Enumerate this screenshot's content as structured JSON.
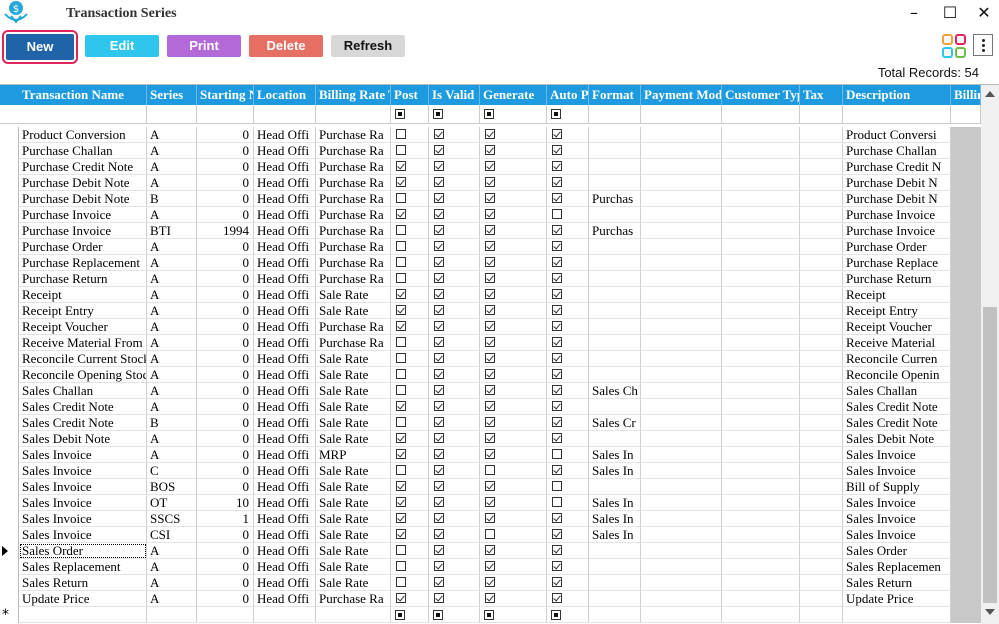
{
  "window": {
    "title": "Transaction Series"
  },
  "toolbar": {
    "new": "New",
    "edit": "Edit",
    "print": "Print",
    "delete": "Delete",
    "refresh": "Refresh"
  },
  "total_records": "Total Records: 54",
  "columns": [
    "Transaction Name",
    "Series",
    "Starting N",
    "Location",
    "Billing Rate Type",
    "Post",
    "Is Valid",
    "Generate",
    "Auto Post",
    "Format",
    "Payment Mode Type",
    "Customer Type",
    "Tax",
    "Description",
    "Billing"
  ],
  "rows": [
    {
      "name": "Product Conversion",
      "series": "A",
      "start": "0",
      "loc": "Head Offi",
      "rate": "Purchase Ra",
      "post": false,
      "valid": true,
      "gen": true,
      "auto": true,
      "fmt": "",
      "desc": "Product Conversi"
    },
    {
      "name": "Purchase Challan",
      "series": "A",
      "start": "0",
      "loc": "Head Offi",
      "rate": "Purchase Ra",
      "post": false,
      "valid": true,
      "gen": true,
      "auto": true,
      "fmt": "",
      "desc": "Purchase Challan"
    },
    {
      "name": "Purchase Credit Note",
      "series": "A",
      "start": "0",
      "loc": "Head Offi",
      "rate": "Purchase Ra",
      "post": true,
      "valid": true,
      "gen": true,
      "auto": true,
      "fmt": "",
      "desc": "Purchase Credit N"
    },
    {
      "name": "Purchase Debit Note",
      "series": "A",
      "start": "0",
      "loc": "Head Offi",
      "rate": "Purchase Ra",
      "post": true,
      "valid": true,
      "gen": true,
      "auto": true,
      "fmt": "",
      "desc": "Purchase Debit N"
    },
    {
      "name": "Purchase Debit Note",
      "series": "B",
      "start": "0",
      "loc": "Head Offi",
      "rate": "Purchase Ra",
      "post": false,
      "valid": true,
      "gen": true,
      "auto": true,
      "fmt": "Purchas",
      "desc": "Purchase Debit N"
    },
    {
      "name": "Purchase Invoice",
      "series": "A",
      "start": "0",
      "loc": "Head Offi",
      "rate": "Purchase Ra",
      "post": true,
      "valid": true,
      "gen": true,
      "auto": false,
      "fmt": "",
      "desc": "Purchase Invoice"
    },
    {
      "name": "Purchase Invoice",
      "series": "BTI",
      "start": "1994",
      "loc": "Head Offi",
      "rate": "Purchase Ra",
      "post": false,
      "valid": true,
      "gen": true,
      "auto": true,
      "fmt": "Purchas",
      "desc": "Purchase Invoice"
    },
    {
      "name": "Purchase Order",
      "series": "A",
      "start": "0",
      "loc": "Head Offi",
      "rate": "Purchase Ra",
      "post": false,
      "valid": true,
      "gen": true,
      "auto": true,
      "fmt": "",
      "desc": "Purchase Order"
    },
    {
      "name": "Purchase Replacement",
      "series": "A",
      "start": "0",
      "loc": "Head Offi",
      "rate": "Purchase Ra",
      "post": false,
      "valid": true,
      "gen": true,
      "auto": true,
      "fmt": "",
      "desc": "Purchase Replace"
    },
    {
      "name": "Purchase Return",
      "series": "A",
      "start": "0",
      "loc": "Head Offi",
      "rate": "Purchase Ra",
      "post": false,
      "valid": true,
      "gen": true,
      "auto": true,
      "fmt": "",
      "desc": "Purchase Return"
    },
    {
      "name": "Receipt",
      "series": "A",
      "start": "0",
      "loc": "Head Offi",
      "rate": "Sale Rate",
      "post": true,
      "valid": true,
      "gen": true,
      "auto": true,
      "fmt": "",
      "desc": "Receipt"
    },
    {
      "name": "Receipt Entry",
      "series": "A",
      "start": "0",
      "loc": "Head Offi",
      "rate": "Sale Rate",
      "post": true,
      "valid": true,
      "gen": true,
      "auto": true,
      "fmt": "",
      "desc": "Receipt Entry"
    },
    {
      "name": "Receipt Voucher",
      "series": "A",
      "start": "0",
      "loc": "Head Offi",
      "rate": "Purchase Ra",
      "post": true,
      "valid": true,
      "gen": true,
      "auto": true,
      "fmt": "",
      "desc": "Receipt Voucher"
    },
    {
      "name": "Receive Material From",
      "series": "A",
      "start": "0",
      "loc": "Head Offi",
      "rate": "Purchase Ra",
      "post": false,
      "valid": true,
      "gen": true,
      "auto": true,
      "fmt": "",
      "desc": "Receive Material"
    },
    {
      "name": "Reconcile Current Stock",
      "series": "A",
      "start": "0",
      "loc": "Head Offi",
      "rate": "Sale Rate",
      "post": false,
      "valid": true,
      "gen": true,
      "auto": true,
      "fmt": "",
      "desc": "Reconcile Curren"
    },
    {
      "name": "Reconcile Opening Stock",
      "series": "A",
      "start": "0",
      "loc": "Head Offi",
      "rate": "Sale Rate",
      "post": false,
      "valid": true,
      "gen": true,
      "auto": true,
      "fmt": "",
      "desc": "Reconcile Openin"
    },
    {
      "name": "Sales Challan",
      "series": "A",
      "start": "0",
      "loc": "Head Offi",
      "rate": "Sale Rate",
      "post": false,
      "valid": true,
      "gen": true,
      "auto": true,
      "fmt": "Sales Ch",
      "desc": "Sales Challan"
    },
    {
      "name": "Sales Credit Note",
      "series": "A",
      "start": "0",
      "loc": "Head Offi",
      "rate": "Sale Rate",
      "post": true,
      "valid": true,
      "gen": true,
      "auto": true,
      "fmt": "",
      "desc": "Sales Credit Note"
    },
    {
      "name": "Sales Credit Note",
      "series": "B",
      "start": "0",
      "loc": "Head Offi",
      "rate": "Sale Rate",
      "post": false,
      "valid": true,
      "gen": true,
      "auto": true,
      "fmt": "Sales Cr",
      "desc": "Sales Credit Note"
    },
    {
      "name": "Sales Debit Note",
      "series": "A",
      "start": "0",
      "loc": "Head Offi",
      "rate": "Sale Rate",
      "post": true,
      "valid": true,
      "gen": true,
      "auto": true,
      "fmt": "",
      "desc": "Sales Debit Note"
    },
    {
      "name": "Sales Invoice",
      "series": "A",
      "start": "0",
      "loc": "Head Offi",
      "rate": "MRP",
      "post": true,
      "valid": true,
      "gen": true,
      "auto": false,
      "fmt": "Sales In",
      "desc": "Sales Invoice"
    },
    {
      "name": "Sales Invoice",
      "series": "C",
      "start": "0",
      "loc": "Head Offi",
      "rate": "Sale Rate",
      "post": false,
      "valid": true,
      "gen": false,
      "auto": true,
      "fmt": "Sales In",
      "desc": "Sales Invoice"
    },
    {
      "name": "Sales Invoice",
      "series": "BOS",
      "start": "0",
      "loc": "Head Offi",
      "rate": "Sale Rate",
      "post": true,
      "valid": true,
      "gen": true,
      "auto": false,
      "fmt": "",
      "desc": "Bill of Supply"
    },
    {
      "name": "Sales Invoice",
      "series": "OT",
      "start": "10",
      "loc": "Head Offi",
      "rate": "Sale Rate",
      "post": true,
      "valid": true,
      "gen": true,
      "auto": false,
      "fmt": "Sales In",
      "desc": "Sales Invoice"
    },
    {
      "name": "Sales Invoice",
      "series": "SSCS",
      "start": "1",
      "loc": "Head Offi",
      "rate": "Sale Rate",
      "post": true,
      "valid": true,
      "gen": true,
      "auto": true,
      "fmt": "Sales In",
      "desc": "Sales Invoice"
    },
    {
      "name": "Sales Invoice",
      "series": "CSI",
      "start": "0",
      "loc": "Head Offi",
      "rate": "Sale Rate",
      "post": true,
      "valid": true,
      "gen": false,
      "auto": true,
      "fmt": "Sales In",
      "desc": "Sales Invoice"
    },
    {
      "name": "Sales Order",
      "series": "A",
      "start": "0",
      "loc": "Head Offi",
      "rate": "Sale Rate",
      "post": false,
      "valid": true,
      "gen": true,
      "auto": true,
      "fmt": "",
      "desc": "Sales Order"
    },
    {
      "name": "Sales Replacement",
      "series": "A",
      "start": "0",
      "loc": "Head Offi",
      "rate": "Sale Rate",
      "post": false,
      "valid": true,
      "gen": true,
      "auto": true,
      "fmt": "",
      "desc": "Sales Replacemen"
    },
    {
      "name": "Sales Return",
      "series": "A",
      "start": "0",
      "loc": "Head Offi",
      "rate": "Sale Rate",
      "post": false,
      "valid": true,
      "gen": true,
      "auto": true,
      "fmt": "",
      "desc": "Sales Return"
    },
    {
      "name": "Update Price",
      "series": "A",
      "start": "0",
      "loc": "Head Offi",
      "rate": "Purchase Ra",
      "post": true,
      "valid": true,
      "gen": true,
      "auto": true,
      "fmt": "",
      "desc": "Update Price"
    }
  ],
  "current_row_index": 26,
  "icons": {
    "app_logo": "app-logo-icon",
    "apps_grid": "apps-grid-icon",
    "more": "more-vertical-icon",
    "minimize": "minimize-icon",
    "maximize": "maximize-icon",
    "close": "close-icon"
  },
  "colors": {
    "header_bg": "#1e9be0",
    "new_btn": "#1f63a8",
    "edit_btn": "#2ec6ec",
    "print_btn": "#b36ad8",
    "delete_btn": "#e46f62",
    "highlight": "#e0245e"
  }
}
